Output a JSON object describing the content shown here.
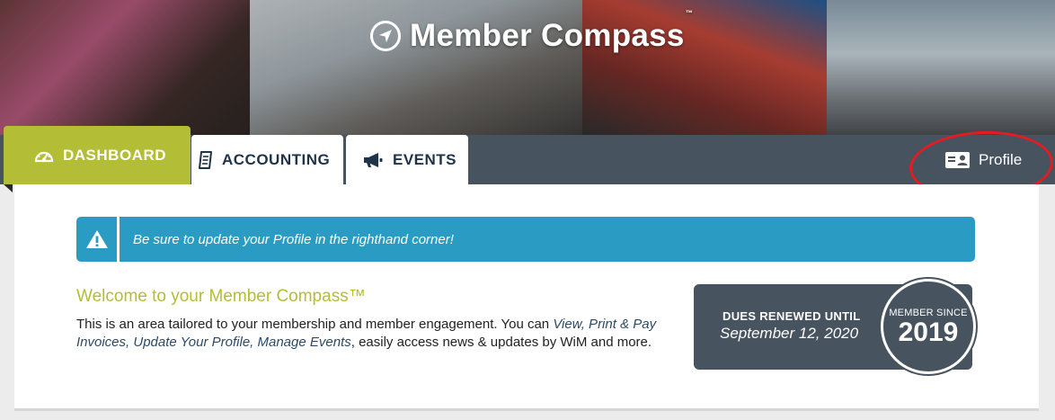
{
  "brand": {
    "title": "Member Compass",
    "tm": "™"
  },
  "nav": {
    "tabs": [
      {
        "label": "DASHBOARD",
        "icon": "dashboard-gauge-icon",
        "active": true
      },
      {
        "label": "ACCOUNTING",
        "icon": "receipt-icon",
        "active": false
      },
      {
        "label": "EVENTS",
        "icon": "megaphone-icon",
        "active": false
      }
    ],
    "profile": {
      "label": "Profile",
      "icon": "id-card-icon"
    }
  },
  "alert": {
    "text": "Be sure to update your Profile in the righthand corner!",
    "icon": "warning-icon"
  },
  "welcome": {
    "title": "Welcome to your Member Compass™",
    "body_prefix": "This is an area tailored to your membership and member engagement. You can ",
    "links": "View, Print & Pay Invoices, Update Your Profile, Manage Events",
    "body_suffix": ", easily access news & updates by WiM and more."
  },
  "dues": {
    "label": "DUES RENEWED UNTIL",
    "date": "September 12, 2020",
    "since_label": "MEMBER SINCE",
    "since_year": "2019"
  },
  "colors": {
    "accent": "#b4bd36",
    "nav_bg": "#47535e",
    "alert_bg": "#2a9bc3",
    "annotation": "#e31b23",
    "tab_text": "#1f3349"
  }
}
